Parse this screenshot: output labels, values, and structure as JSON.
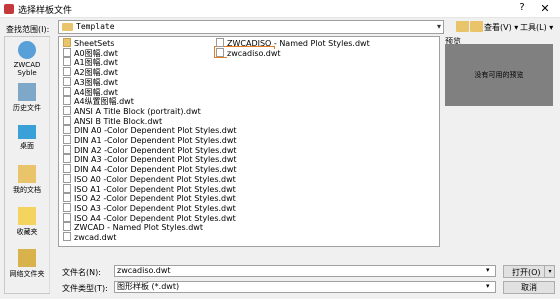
{
  "window": {
    "title": "选择样板文件",
    "help": "?",
    "close": "✕"
  },
  "toolbar": {
    "lookin_label": "查找范围(I):",
    "lookin_value": "Template",
    "view_label": "查看(V) ▾",
    "tools_label": "工具(L) ▾"
  },
  "places": [
    {
      "label": "ZWCAD Syble",
      "icon": "cloud-icon"
    },
    {
      "label": "历史文件",
      "icon": "history-icon"
    },
    {
      "label": "桌面",
      "icon": "desktop-icon"
    },
    {
      "label": "我的文档",
      "icon": "documents-icon"
    },
    {
      "label": "收藏夹",
      "icon": "favorites-icon"
    },
    {
      "label": "网络文件夹",
      "icon": "network-folder-icon"
    }
  ],
  "files_col1": [
    {
      "name": "SheetSets",
      "type": "folder"
    },
    {
      "name": "A0图幅.dwt",
      "type": "file"
    },
    {
      "name": "A1图幅.dwt",
      "type": "file"
    },
    {
      "name": "A2图幅.dwt",
      "type": "file"
    },
    {
      "name": "A3图幅.dwt",
      "type": "file"
    },
    {
      "name": "A4图幅.dwt",
      "type": "file"
    },
    {
      "name": "A4纵置图幅.dwt",
      "type": "file"
    },
    {
      "name": "ANSI A Title Block (portrait).dwt",
      "type": "file"
    },
    {
      "name": "ANSI B Title Block.dwt",
      "type": "file"
    },
    {
      "name": "DIN A0 -Color Dependent Plot Styles.dwt",
      "type": "file"
    },
    {
      "name": "DIN A1 -Color Dependent Plot Styles.dwt",
      "type": "file"
    },
    {
      "name": "DIN A2 -Color Dependent Plot Styles.dwt",
      "type": "file"
    },
    {
      "name": "DIN A3 -Color Dependent Plot Styles.dwt",
      "type": "file"
    },
    {
      "name": "DIN A4 -Color Dependent Plot Styles.dwt",
      "type": "file"
    },
    {
      "name": "ISO A0 -Color Dependent Plot Styles.dwt",
      "type": "file"
    },
    {
      "name": "ISO A1 -Color Dependent Plot Styles.dwt",
      "type": "file"
    },
    {
      "name": "ISO A2 -Color Dependent Plot Styles.dwt",
      "type": "file"
    },
    {
      "name": "ISO A3 -Color Dependent Plot Styles.dwt",
      "type": "file"
    },
    {
      "name": "ISO A4 -Color Dependent Plot Styles.dwt",
      "type": "file"
    },
    {
      "name": "ZWCAD - Named Plot Styles.dwt",
      "type": "file"
    },
    {
      "name": "zwcad.dwt",
      "type": "file"
    }
  ],
  "files_col2": [
    {
      "name": "ZWCADISO - Named Plot Styles.dwt",
      "type": "file"
    },
    {
      "name": "zwcadiso.dwt",
      "type": "file",
      "selected": true
    }
  ],
  "preview": {
    "label": "预览",
    "text": "没有可用的预览"
  },
  "bottom": {
    "filename_label": "文件名(N):",
    "filename_value": "zwcadiso.dwt",
    "filetype_label": "文件类型(T):",
    "filetype_value": "图形样板 (*.dwt)",
    "open_label": "打开(O)",
    "cancel_label": "取消"
  },
  "colors": {
    "selection_border": "#e67e22",
    "preview_bg": "#808080"
  }
}
